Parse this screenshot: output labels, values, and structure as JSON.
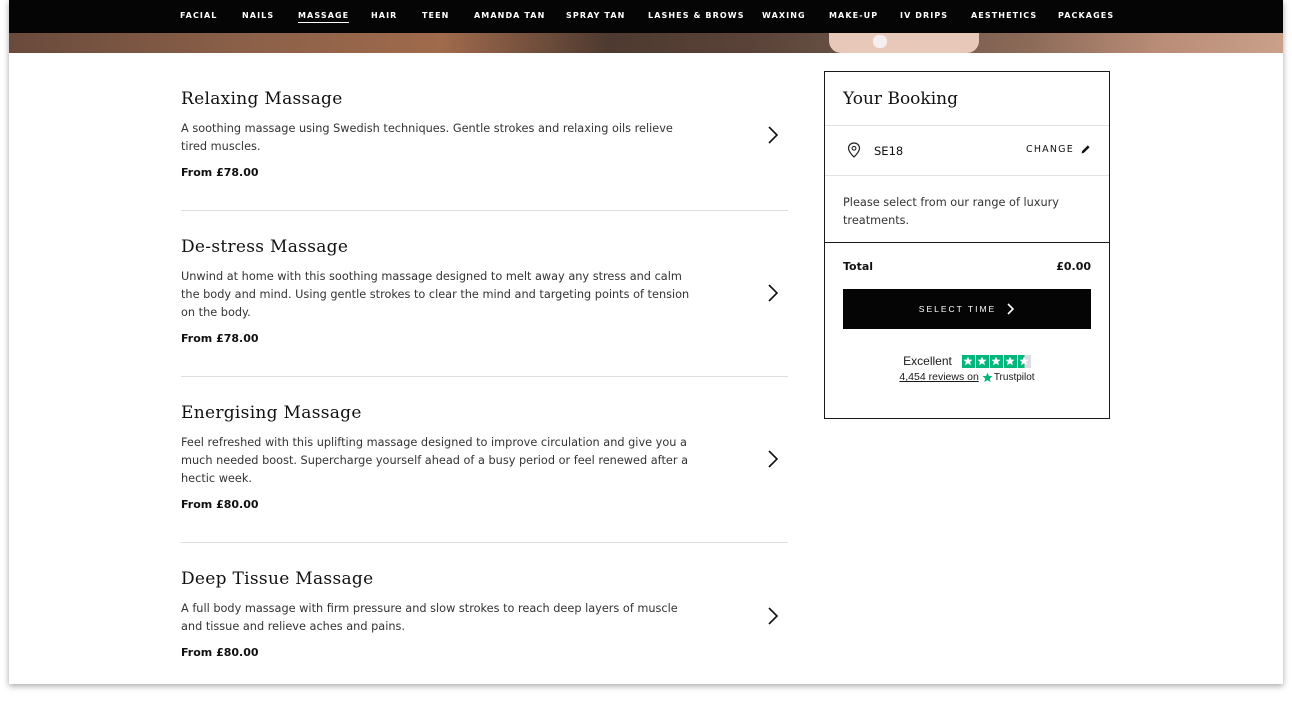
{
  "nav": {
    "items": [
      {
        "label": "FACIAL"
      },
      {
        "label": "NAILS"
      },
      {
        "label": "MASSAGE"
      },
      {
        "label": "HAIR"
      },
      {
        "label": "TEEN"
      },
      {
        "label": "AMANDA TAN"
      },
      {
        "label": "SPRAY TAN"
      },
      {
        "label": "LASHES & BROWS"
      },
      {
        "label": "WAXING"
      },
      {
        "label": "MAKE-UP"
      },
      {
        "label": "IV DRIPS"
      },
      {
        "label": "AESTHETICS"
      },
      {
        "label": "PACKAGES"
      }
    ],
    "active": "MASSAGE"
  },
  "treatments": [
    {
      "title": "Relaxing Massage",
      "description": "A soothing massage using Swedish techniques. Gentle strokes and relaxing oils relieve tired muscles.",
      "price": "From £78.00"
    },
    {
      "title": "De-stress Massage",
      "description": "Unwind at home with this soothing massage designed to melt away any stress and calm the body and mind. Using gentle strokes to clear the mind and targeting points of tension on the body.",
      "price": "From £78.00"
    },
    {
      "title": "Energising Massage",
      "description": "Feel refreshed with this uplifting massage designed to improve circulation and give you a much needed boost. Supercharge yourself ahead of a busy period or feel renewed after a hectic week.",
      "price": "From £80.00"
    },
    {
      "title": "Deep Tissue Massage",
      "description": "A full body massage with firm pressure and slow strokes to reach deep layers of muscle and tissue and relieve aches and pains.",
      "price": "From £80.00"
    }
  ],
  "booking": {
    "title": "Your Booking",
    "postcode": "SE18",
    "change_label": "CHANGE",
    "message": "Please select from our range of luxury treatments.",
    "total_label": "Total",
    "total_value": "£0.00",
    "select_time_label": "SELECT TIME"
  },
  "trustpilot": {
    "rating_label": "Excellent",
    "reviews_text": "4,454 reviews on",
    "brand": "Trustpilot",
    "stars": 4.5,
    "star_color": "#00b67a"
  },
  "colors": {
    "nav_bg": "#050505",
    "button_bg": "#050505"
  }
}
